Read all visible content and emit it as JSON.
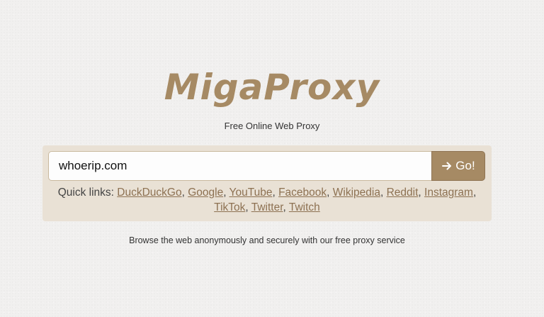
{
  "logo": {
    "text": "MigaProxy"
  },
  "tagline": "Free Online Web Proxy",
  "search": {
    "value": "whoerip.com",
    "button_label": "Go!",
    "button_icon": "arrow-right-icon"
  },
  "quick_links": {
    "label": "Quick links:",
    "links": [
      {
        "label": "DuckDuckGo"
      },
      {
        "label": "Google"
      },
      {
        "label": "YouTube"
      },
      {
        "label": "Facebook"
      },
      {
        "label": "Wikipedia"
      },
      {
        "label": "Reddit"
      },
      {
        "label": "Instagram"
      },
      {
        "label": "TikTok"
      },
      {
        "label": "Twitter"
      },
      {
        "label": "Twitch"
      }
    ]
  },
  "footer": "Browse the web anonymously and securely with our free proxy service",
  "colors": {
    "brand": "#a68a64",
    "panel": "#e9e1d5",
    "link": "#8d7152",
    "background": "#f1f0ef"
  }
}
